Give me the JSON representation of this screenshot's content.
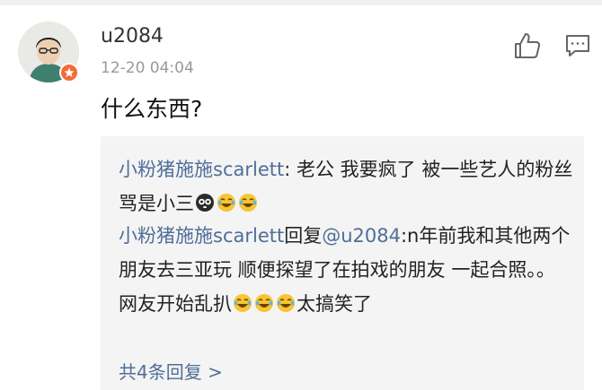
{
  "comment": {
    "username": "u2084",
    "timestamp": "12-20 04:04",
    "text": "什么东西?"
  },
  "icons": {
    "verified_badge": "verified-star-icon",
    "like": "thumbs-up-icon",
    "reply": "comment-bubble-icon"
  },
  "replies": [
    {
      "author": "小粉猪施施scarlett",
      "separator": ": ",
      "text": "老公 我要疯了 被一些艺人的粉丝骂是小三",
      "trailing_emojis": [
        "ghost-emoji",
        "laugh-cry-emoji",
        "laugh-cry-emoji"
      ]
    },
    {
      "author": "小粉猪施施scarlett",
      "reply_word": "回复",
      "mention": "@u2084",
      "text_before": ":n年前我和其他两个朋友去三亚玩 顺便探望了在拍戏的朋友 一起合照。。 网友开始乱扒",
      "inline_emojis": [
        "laugh-cry-emoji",
        "laugh-cry-emoji",
        "laugh-cry-emoji"
      ],
      "text_after": "太搞笑了"
    }
  ],
  "more_replies_label": "共4条回复 >",
  "colors": {
    "link": "#4f6e97",
    "badge": "#f56b36",
    "reply_bg": "#f4f4f4",
    "timestamp": "#999999"
  }
}
